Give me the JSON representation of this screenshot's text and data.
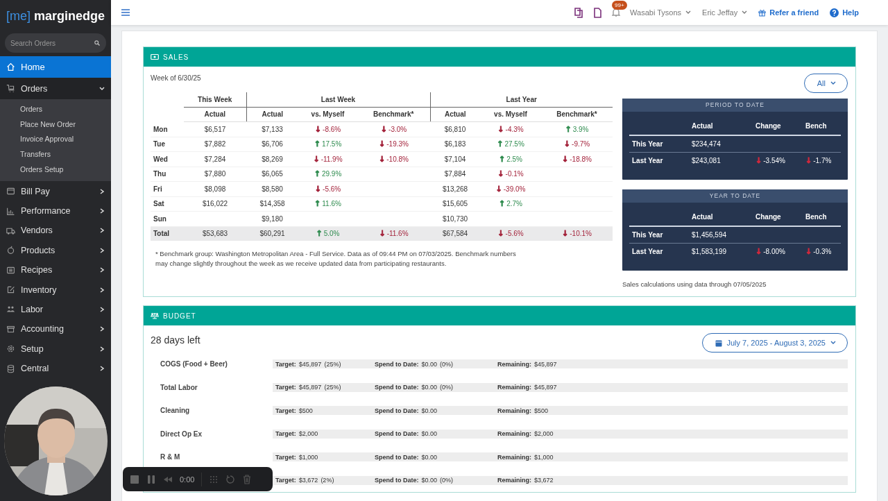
{
  "brand": {
    "bracket": "[me]",
    "name": "marginedge"
  },
  "search": {
    "placeholder": "Search Orders"
  },
  "sidebar": {
    "items": [
      {
        "label": "Home",
        "selected": true
      },
      {
        "label": "Orders",
        "selected": false,
        "expanded": true,
        "children": [
          {
            "label": "Orders"
          },
          {
            "label": "Place New Order"
          },
          {
            "label": "Invoice Approval"
          },
          {
            "label": "Transfers"
          },
          {
            "label": "Orders Setup"
          }
        ]
      },
      {
        "label": "Bill Pay",
        "selected": false,
        "expanded": false
      },
      {
        "label": "Performance",
        "selected": false,
        "expanded": false
      },
      {
        "label": "Vendors",
        "selected": false,
        "expanded": false
      },
      {
        "label": "Products",
        "selected": false,
        "expanded": false
      },
      {
        "label": "Recipes",
        "selected": false,
        "expanded": false
      },
      {
        "label": "Inventory",
        "selected": false,
        "expanded": false
      },
      {
        "label": "Labor",
        "selected": false,
        "expanded": false
      },
      {
        "label": "Accounting",
        "selected": false,
        "expanded": false
      },
      {
        "label": "Setup",
        "selected": false,
        "expanded": false
      },
      {
        "label": "Central",
        "selected": false,
        "expanded": false
      }
    ]
  },
  "topbar": {
    "badge": "99+",
    "restaurant": "Wasabi Tysons",
    "user": "Eric Jeffay",
    "refer": "Refer a friend",
    "help": "Help"
  },
  "sales": {
    "title": "SALES",
    "week": "Week of 6/30/25",
    "filter": "All",
    "groups": [
      "This Week",
      "Last Week",
      "Last Year"
    ],
    "columns": [
      "Actual",
      "Actual",
      "vs. Myself",
      "Benchmark*",
      "Actual",
      "vs. Myself",
      "Benchmark*"
    ],
    "rows": [
      {
        "day": "Mon",
        "total": false,
        "cells": [
          "$6,517",
          "$7,133",
          {
            "arrow": "↓",
            "text": "-8.6%",
            "color": "#a3223a"
          },
          {
            "arrow": "↓",
            "text": "-3.0%",
            "color": "#a3223a"
          },
          "$6,810",
          {
            "arrow": "↓",
            "text": "-4.3%",
            "color": "#a3223a"
          },
          {
            "arrow": "↑",
            "text": "3.9%",
            "color": "#2e8b4e"
          }
        ]
      },
      {
        "day": "Tue",
        "total": false,
        "cells": [
          "$7,882",
          "$6,706",
          {
            "arrow": "↑",
            "text": "17.5%",
            "color": "#2e8b4e"
          },
          {
            "arrow": "↓",
            "text": "-19.3%",
            "color": "#a3223a"
          },
          "$6,183",
          {
            "arrow": "↑",
            "text": "27.5%",
            "color": "#2e8b4e"
          },
          {
            "arrow": "↓",
            "text": "-9.7%",
            "color": "#a3223a"
          }
        ]
      },
      {
        "day": "Wed",
        "total": false,
        "cells": [
          "$7,284",
          "$8,269",
          {
            "arrow": "↓",
            "text": "-11.9%",
            "color": "#a3223a"
          },
          {
            "arrow": "↓",
            "text": "-10.8%",
            "color": "#a3223a"
          },
          "$7,104",
          {
            "arrow": "↑",
            "text": "2.5%",
            "color": "#2e8b4e"
          },
          {
            "arrow": "↓",
            "text": "-18.8%",
            "color": "#a3223a"
          }
        ]
      },
      {
        "day": "Thu",
        "total": false,
        "cells": [
          "$7,880",
          "$6,065",
          {
            "arrow": "↑",
            "text": "29.9%",
            "color": "#2e8b4e"
          },
          null,
          "$7,884",
          {
            "arrow": "↓",
            "text": "-0.1%",
            "color": "#a3223a"
          },
          null
        ]
      },
      {
        "day": "Fri",
        "total": false,
        "cells": [
          "$8,098",
          "$8,580",
          {
            "arrow": "↓",
            "text": "-5.6%",
            "color": "#a3223a"
          },
          null,
          "$13,268",
          {
            "arrow": "↓",
            "text": "-39.0%",
            "color": "#a3223a"
          },
          null
        ]
      },
      {
        "day": "Sat",
        "total": false,
        "cells": [
          "$16,022",
          "$14,358",
          {
            "arrow": "↑",
            "text": "11.6%",
            "color": "#2e8b4e"
          },
          null,
          "$15,605",
          {
            "arrow": "↑",
            "text": "2.7%",
            "color": "#2e8b4e"
          },
          null
        ]
      },
      {
        "day": "Sun",
        "total": false,
        "cells": [
          null,
          "$9,180",
          null,
          null,
          "$10,730",
          null,
          null
        ]
      },
      {
        "day": "Total",
        "total": true,
        "cells": [
          "$53,683",
          "$60,291",
          {
            "arrow": "↑",
            "text": "5.0%",
            "color": "#2e8b4e"
          },
          {
            "arrow": "↓",
            "text": "-11.6%",
            "color": "#a3223a"
          },
          "$67,584",
          {
            "arrow": "↓",
            "text": "-5.6%",
            "color": "#a3223a"
          },
          {
            "arrow": "↓",
            "text": "-10.1%",
            "color": "#a3223a"
          }
        ]
      }
    ],
    "footnote": "* Benchmark group: Washington Metropolitan Area - Full Service. Data as of 09:44 PM on 07/03/2025. Benchmark numbers may change slightly throughout the week as we receive updated data from participating restaurants.",
    "panels": [
      {
        "title": "PERIOD TO DATE",
        "columns": [
          "Actual",
          "Change",
          "Bench"
        ],
        "rows": [
          {
            "label": "This Year",
            "actual": "$234,474"
          },
          {
            "label": "Last Year",
            "actual": "$243,081",
            "change": {
              "arrow": "↓",
              "text": "-3.54%",
              "color": "#d0283c"
            },
            "bench": {
              "arrow": "↓",
              "text": "-1.7%",
              "color": "#d0283c"
            }
          }
        ]
      },
      {
        "title": "YEAR TO DATE",
        "columns": [
          "Actual",
          "Change",
          "Bench"
        ],
        "rows": [
          {
            "label": "This Year",
            "actual": "$1,456,594"
          },
          {
            "label": "Last Year",
            "actual": "$1,583,199",
            "change": {
              "arrow": "↓",
              "text": "-8.00%",
              "color": "#d0283c"
            },
            "bench": {
              "arrow": "↓",
              "text": "-0.3%",
              "color": "#d0283c"
            }
          }
        ]
      }
    ],
    "note": "Sales calculations using data through 07/05/2025"
  },
  "budget": {
    "title": "BUDGET",
    "days_left": "28 days left",
    "range": "July 7, 2025 - August 3, 2025",
    "rows": [
      {
        "name": "COGS (Food + Beer)",
        "target_label": "Target:",
        "target": "$45,897",
        "target_pct": "(25%)",
        "spend_label": "Spend to Date:",
        "spend": "$0.00",
        "spend_pct": "(0%)",
        "remaining_label": "Remaining:",
        "remaining": "$45,897"
      },
      {
        "name": "Total Labor",
        "target_label": "Target:",
        "target": "$45,897",
        "target_pct": "(25%)",
        "spend_label": "Spend to Date:",
        "spend": "$0.00",
        "spend_pct": "(0%)",
        "remaining_label": "Remaining:",
        "remaining": "$45,897"
      },
      {
        "name": "Cleaning",
        "target_label": "Target:",
        "target": "$500",
        "spend_label": "Spend to Date:",
        "spend": "$0.00",
        "remaining_label": "Remaining:",
        "remaining": "$500"
      },
      {
        "name": "Direct Op Ex",
        "target_label": "Target:",
        "target": "$2,000",
        "spend_label": "Spend to Date:",
        "spend": "$0.00",
        "remaining_label": "Remaining:",
        "remaining": "$2,000"
      },
      {
        "name": "R & M",
        "target_label": "Target:",
        "target": "$1,000",
        "spend_label": "Spend to Date:",
        "spend": "$0.00",
        "remaining_label": "Remaining:",
        "remaining": "$1,000"
      },
      {
        "target_label": "Target:",
        "target": "$3,672",
        "target_pct": "(2%)",
        "spend_label": "Spend to Date:",
        "spend": "$0.00",
        "spend_pct": "(0%)",
        "remaining_label": "Remaining:",
        "remaining": "$3,672"
      }
    ]
  },
  "recorder": {
    "time": "0:00"
  }
}
